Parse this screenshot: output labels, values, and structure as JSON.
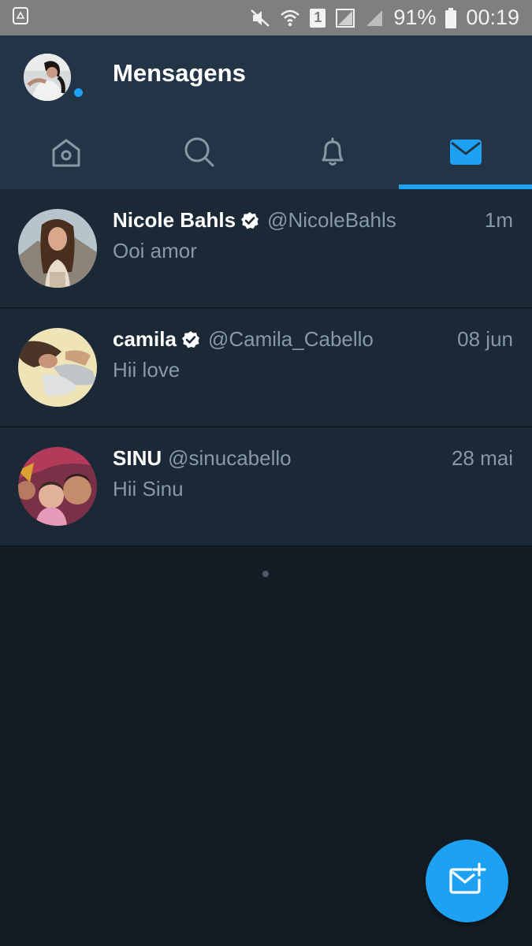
{
  "status_bar": {
    "battery_percent": "91%",
    "time": "00:19",
    "sim_slot": "1",
    "icons": [
      "recycle-icon",
      "mute-icon",
      "wifi-icon",
      "sim-icon",
      "no-signal-icon",
      "signal-icon",
      "battery-icon"
    ]
  },
  "header": {
    "title": "Mensagens",
    "tabs": [
      {
        "name": "home",
        "icon": "home-icon",
        "has_unread": true
      },
      {
        "name": "search",
        "icon": "search-icon"
      },
      {
        "name": "notifications",
        "icon": "bell-icon"
      },
      {
        "name": "messages",
        "icon": "envelope-icon",
        "active": true
      }
    ]
  },
  "conversations": [
    {
      "name": "Nicole Bahls",
      "verified": true,
      "handle": "@NicoleBahls",
      "time": "1m",
      "preview": "Ooi amor"
    },
    {
      "name": "camila",
      "verified": true,
      "handle": "@Camila_Cabello",
      "time": "08 jun",
      "preview": "Hii love"
    },
    {
      "name": "SINU",
      "verified": false,
      "handle": "@sinucabello",
      "time": "28 mai",
      "preview": "Hii Sinu"
    }
  ],
  "colors": {
    "accent": "#1da1f2",
    "header_bg": "#243447",
    "row_bg": "#1b2836",
    "page_bg": "#141d26",
    "secondary_text": "#8899a6"
  },
  "fab": {
    "icon": "compose-message-icon"
  }
}
